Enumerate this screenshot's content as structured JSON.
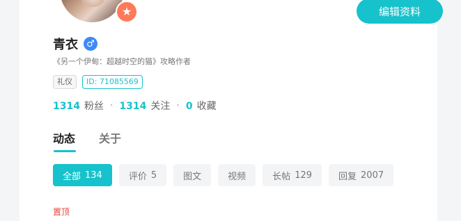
{
  "profile": {
    "name": "青衣",
    "gender_symbol": "♂",
    "subtitle": "《另一个伊甸：超越时空的猫》攻略作者",
    "badge_symbol": "★",
    "edit_label": "编辑资料"
  },
  "tags": [
    "礼仪",
    "ID: 71085569"
  ],
  "stats": [
    {
      "num": "1314",
      "label": "粉丝"
    },
    {
      "num": "1314",
      "label": "关注"
    },
    {
      "num": "0",
      "label": "收藏"
    }
  ],
  "stats_separator": "·",
  "tabs": [
    "动态",
    "关于"
  ],
  "filters": [
    {
      "label": "全部",
      "count": "134"
    },
    {
      "label": "评价",
      "count": "5"
    },
    {
      "label": "图文",
      "count": ""
    },
    {
      "label": "视频",
      "count": ""
    },
    {
      "label": "长帖",
      "count": "129"
    },
    {
      "label": "回复",
      "count": "2007"
    }
  ],
  "pinned_label": "置顶",
  "colors": {
    "accent": "#16c2cc",
    "badge": "#ff7a59",
    "gender": "#3d8af7",
    "pinned": "#e0473e"
  }
}
